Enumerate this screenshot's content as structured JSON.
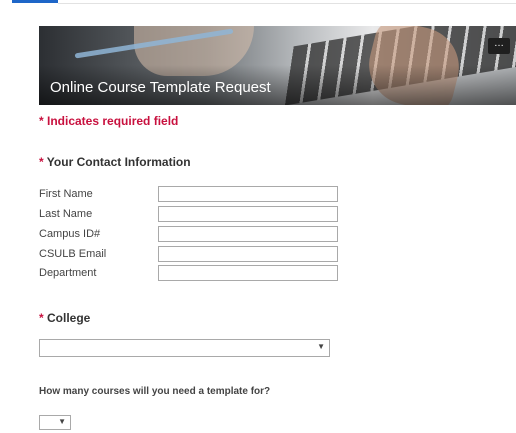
{
  "banner": {
    "title": "Online Course Template Request",
    "menu_icon": "…"
  },
  "required_note": "* Indicates required field",
  "contact_section": {
    "star": "*",
    "title": "Your Contact Information",
    "fields": [
      {
        "label": "First Name",
        "value": ""
      },
      {
        "label": "Last Name",
        "value": ""
      },
      {
        "label": "Campus ID#",
        "value": ""
      },
      {
        "label": "CSULB Email",
        "value": ""
      },
      {
        "label": "Department",
        "value": ""
      }
    ]
  },
  "college_section": {
    "star": "*",
    "title": "College",
    "selected": ""
  },
  "courses_question": "How many courses will you need a template for?",
  "courses_select": {
    "selected": ""
  },
  "colors": {
    "required": "#c8103e",
    "tab_accent": "#1e66c8"
  }
}
